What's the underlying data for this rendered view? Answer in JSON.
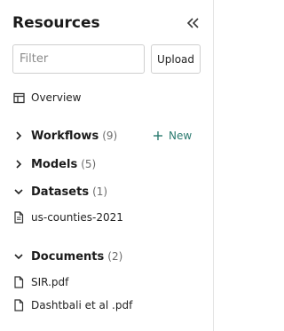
{
  "header": {
    "title": "Resources"
  },
  "search": {
    "placeholder": "Filter",
    "upload_label": "Upload"
  },
  "overview": {
    "label": "Overview"
  },
  "sections": {
    "workflows": {
      "label": "Workflows",
      "count": "(9)",
      "new_label": "New"
    },
    "models": {
      "label": "Models",
      "count": "(5)"
    },
    "datasets": {
      "label": "Datasets",
      "count": "(1)",
      "items": [
        "us-counties-2021"
      ]
    },
    "documents": {
      "label": "Documents",
      "count": "(2)",
      "items": [
        "SIR.pdf",
        "Dashtbali et al .pdf"
      ]
    }
  },
  "colors": {
    "accent": "#2a7a6f",
    "border": "#cfcfcf"
  },
  "icons": {
    "collapse": "double-chevron-left-icon",
    "overview": "layout-icon",
    "expand": "chevron-right-icon",
    "collapse_section": "chevron-down-icon",
    "file": "file-icon",
    "plus": "plus-icon"
  }
}
